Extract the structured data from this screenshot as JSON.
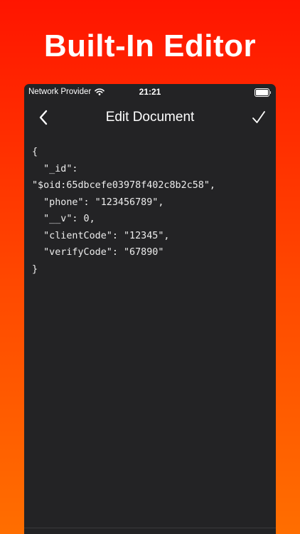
{
  "headline": "Built-In Editor",
  "colors": {
    "gradient_top": "#ff1a00",
    "gradient_bottom": "#ff6a00",
    "phone_background": "#232325",
    "text": "#ffffff"
  },
  "status_bar": {
    "carrier": "Network Provider",
    "time": "21:21",
    "wifi_icon": "wifi-icon",
    "battery_icon": "battery-icon",
    "battery_level": 1.0
  },
  "nav": {
    "title": "Edit Document",
    "back_icon": "chevron-left-icon",
    "done_icon": "checkmark-icon"
  },
  "editor": {
    "content": "{\n  \"_id\":\n\"$oid:65dbcefe03978f402c8b2c58\",\n  \"phone\": \"123456789\",\n  \"__v\": 0,\n  \"clientCode\": \"12345\",\n  \"verifyCode\": \"67890\"\n}"
  }
}
